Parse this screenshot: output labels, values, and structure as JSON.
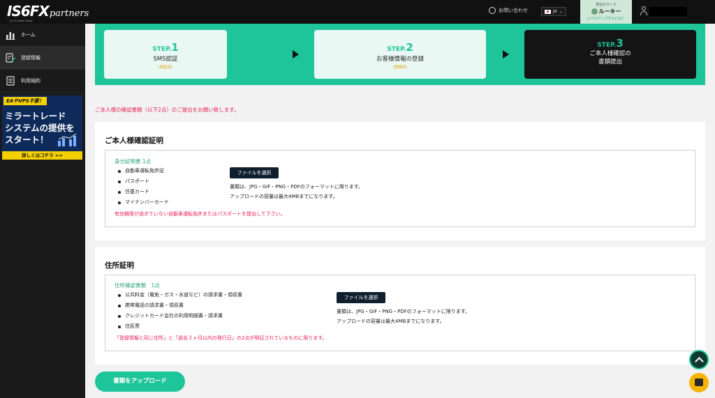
{
  "header": {
    "logo_main": "IS6FX",
    "logo_script": "partners",
    "logo_sub": "by IS Global Group",
    "contact_label": "お問い合わせ",
    "lang_label": "JA",
    "rank_label": "現在のランク",
    "rank_value": "ルーキー",
    "rank_link": "レベルアップするには？"
  },
  "sidebar": {
    "items": [
      {
        "label": "ホーム",
        "icon": "bar-chart-icon"
      },
      {
        "label": "登録情報",
        "icon": "edit-profile-icon"
      },
      {
        "label": "利用規約",
        "icon": "document-icon"
      }
    ],
    "banner": {
      "tag": "EAやVPS不要！",
      "line1": "ミラートレード",
      "line2": "システムの提供を",
      "line3": "スタート！",
      "more": "詳しくはコチラ >>"
    }
  },
  "steps": [
    {
      "prefix": "STEP.",
      "num": "1",
      "name": "SMS認証",
      "status": "(認証済)"
    },
    {
      "prefix": "STEP.",
      "num": "2",
      "name": "お客様情報の登録",
      "status": "(登録済)"
    },
    {
      "prefix": "STEP.",
      "num": "3",
      "name_line1": "ご本人様確認の",
      "name_line2": "書類提出"
    }
  ],
  "notice": "ご本人様の確認書類（以下2点）のご提出をお願い致します。",
  "identity": {
    "heading": "ご本人様確認証明",
    "doc_title": "身分証明書 1点",
    "docs": [
      "自動車運転免許証",
      "パスポート",
      "住基カード",
      "マイナンバーカード"
    ],
    "button": "ファイルを選択",
    "note1": "書類は、JPG・GIF・PNG・PDFのフォーマットに限ります。",
    "note2": "アップロードの容量は最大4MBまでになります。",
    "warning": "有効期限が過ぎていない自動車運転免許またはパスポートを提出して下さい。"
  },
  "address": {
    "heading": "住所証明",
    "doc_title": "住所確認書類　1点",
    "docs": [
      "公共料金（電気・ガス・水道など）の請求書・領収書",
      "携帯電話の請求書・領収書",
      "クレジットカード会社の利用明細書・請求書",
      "住民票"
    ],
    "button": "ファイルを選択",
    "note1": "書類は、JPG・GIF・PNG・PDFのフォーマットに限ります。",
    "note2": "アップロードの容量は最大4MBまでになります。",
    "warning": "「登録情報と同じ住所」と「過去３ヶ月以内の発行日」の2点が明記されているものに限ります。"
  },
  "upload_button": "書類をアップロード",
  "colors": {
    "accent": "#1ec49a",
    "warning": "#e8245a",
    "dark": "#111111"
  }
}
